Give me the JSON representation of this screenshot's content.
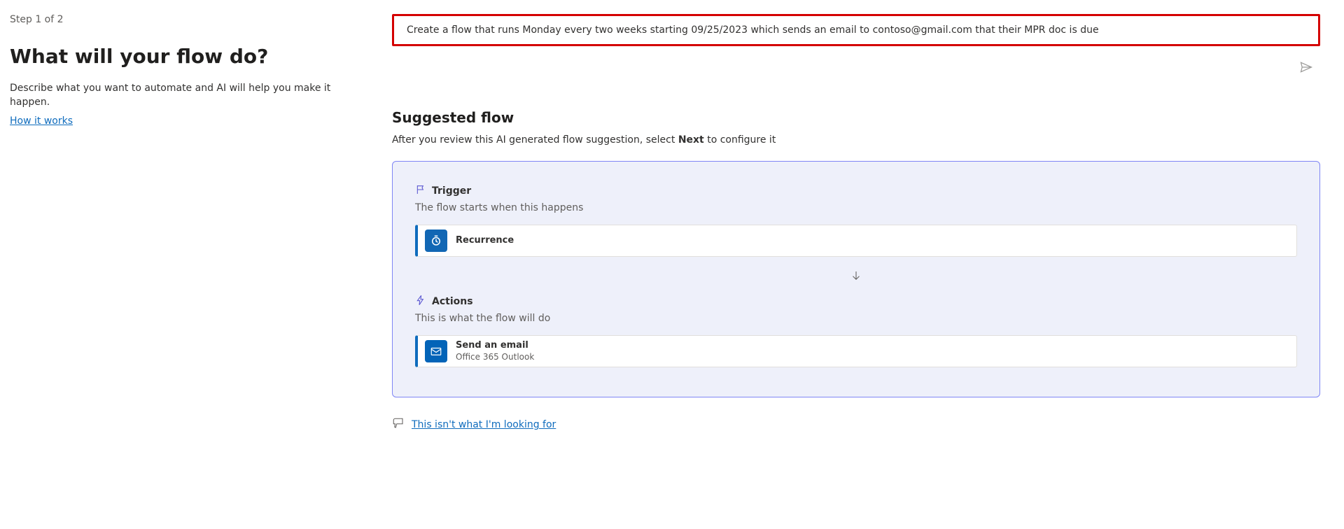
{
  "left": {
    "step": "Step 1 of 2",
    "headline": "What will your flow do?",
    "desc": "Describe what you want to automate and AI will help you make it happen.",
    "howItWorks": "How it works"
  },
  "prompt": {
    "text": "Create a flow that runs Monday every two weeks starting 09/25/2023 which sends an email to contoso@gmail.com that their MPR doc is due"
  },
  "suggested": {
    "heading": "Suggested flow",
    "instruction_pre": "After you review this AI generated flow suggestion, select ",
    "instruction_bold": "Next",
    "instruction_post": " to configure it"
  },
  "trigger": {
    "label": "Trigger",
    "sub": "The flow starts when this happens",
    "card": {
      "title": "Recurrence"
    }
  },
  "actions": {
    "label": "Actions",
    "sub": "This is what the flow will do",
    "card": {
      "title": "Send an email",
      "sub": "Office 365 Outlook"
    }
  },
  "feedback": {
    "link": "This isn't what I'm looking for"
  }
}
